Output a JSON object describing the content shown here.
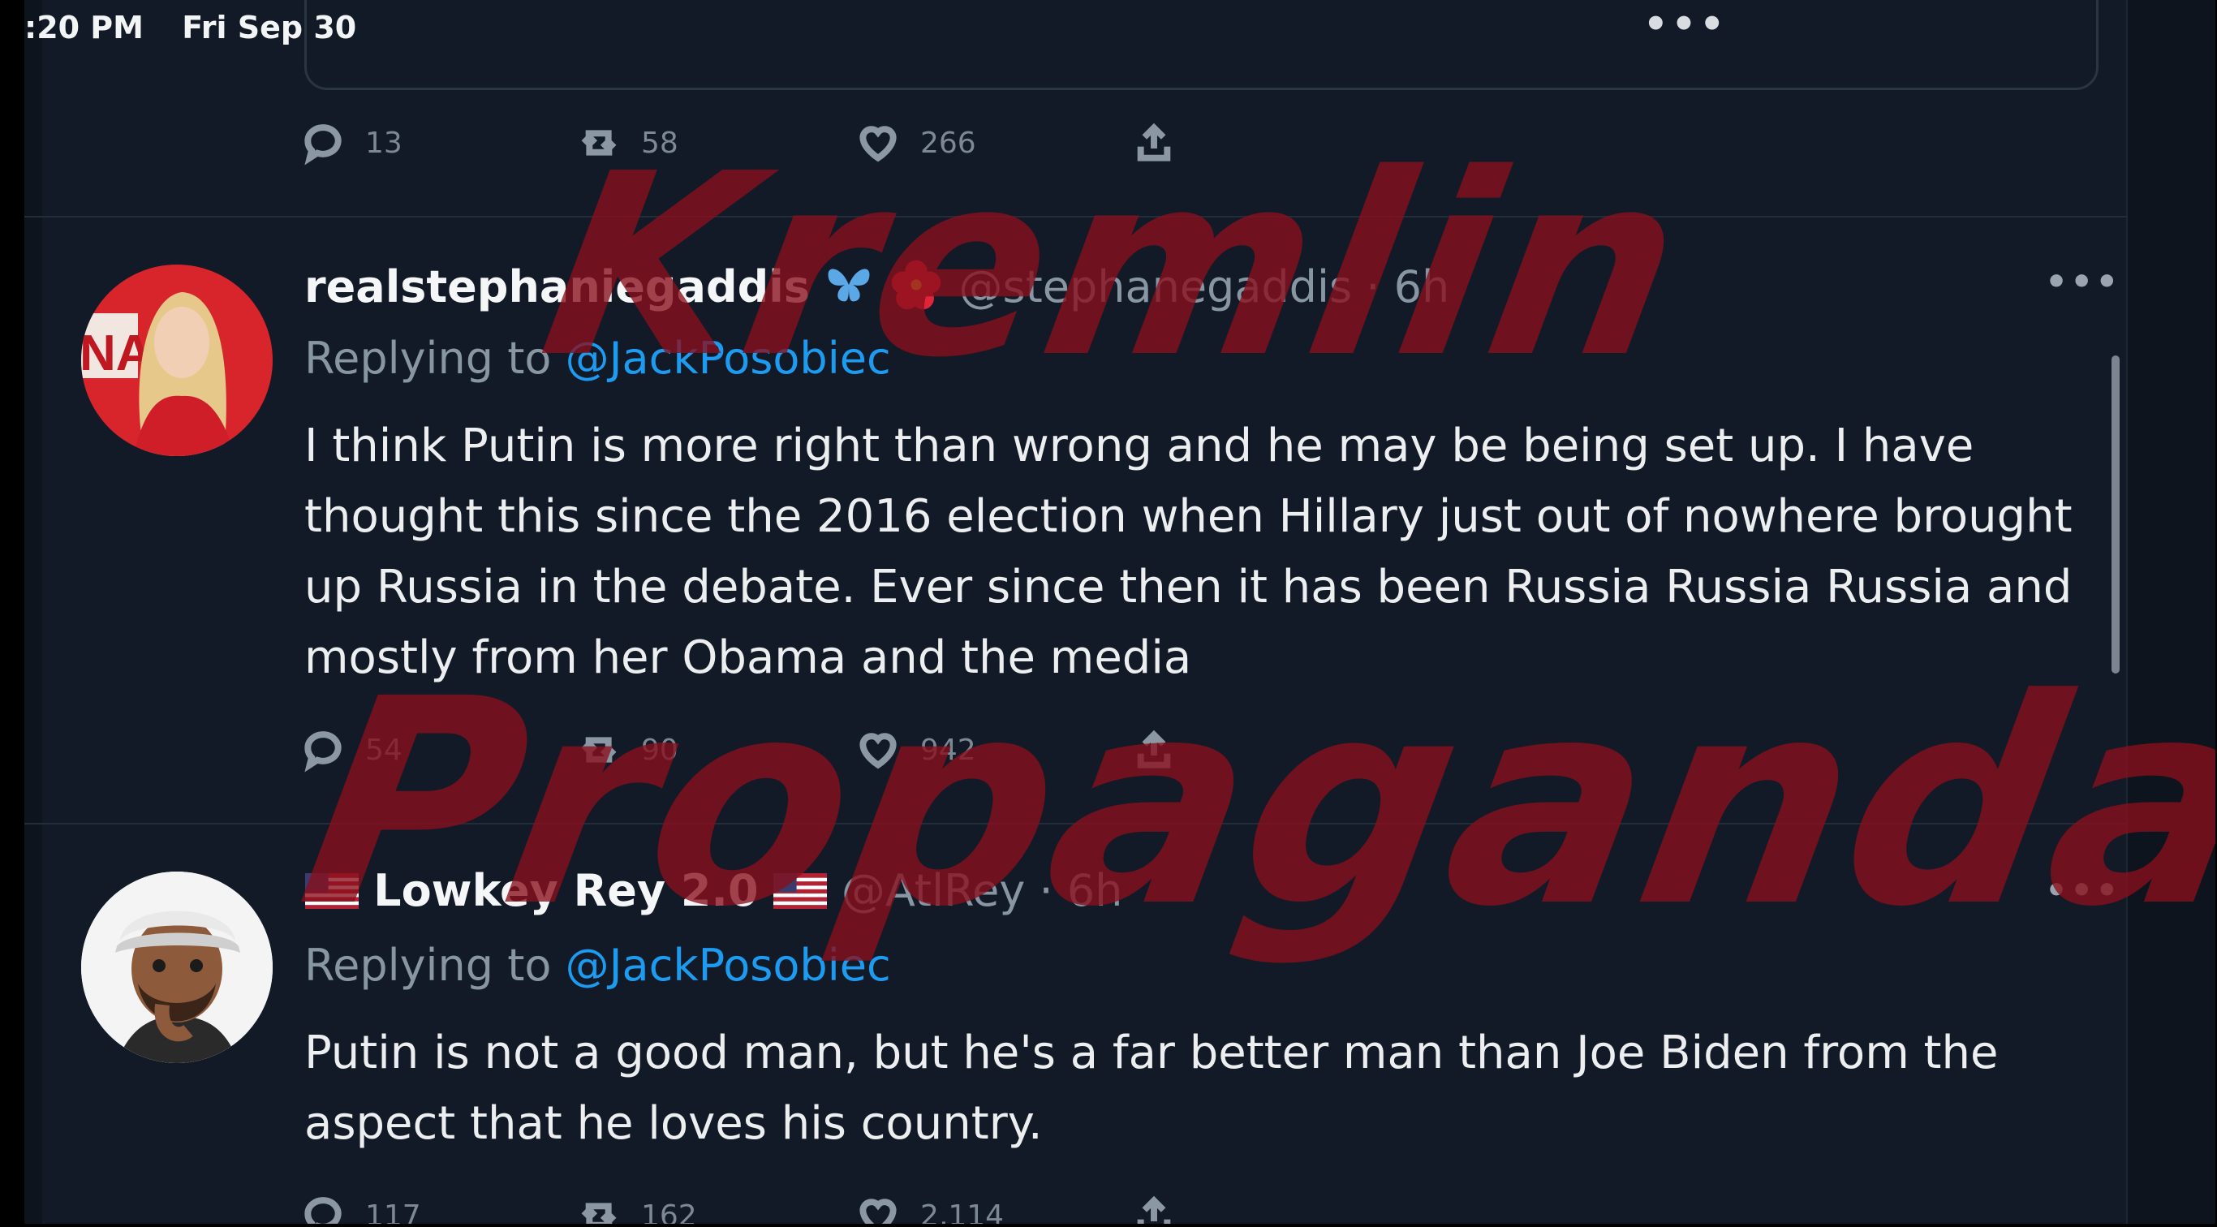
{
  "status": {
    "time": ":20 PM",
    "date": "Fri Sep 30"
  },
  "prev_tweet": {
    "replies": "13",
    "retweets": "58",
    "likes": "266"
  },
  "tweets": [
    {
      "name": "realstephaniegaddis",
      "handle": "@stephanegaddis",
      "time": "· 6h",
      "replying_prefix": "Replying to ",
      "replying_to": "@JackPosobiec",
      "text": "I think Putin is more right than wrong and he may be being set up. I have thought this since the 2016 election when Hillary just out of nowhere brought up Russia in the debate. Ever since then it has been Russia Russia Russia and mostly from her Obama and the media",
      "replies": "54",
      "retweets": "90",
      "likes": "942"
    },
    {
      "name": "Lowkey Rey 2.0",
      "handle": "@AtlRey",
      "time": "· 6h",
      "replying_prefix": "Replying to ",
      "replying_to": "@JackPosobiec",
      "text": "Putin is not a good man, but he's a far better man than Joe Biden from the aspect that he loves his country.",
      "replies": "117",
      "retweets": "162",
      "likes": "2,114"
    }
  ],
  "overlay": {
    "line1": "Kremlin",
    "line2": "Propaganda"
  },
  "colors": {
    "background": "#111a26",
    "accent": "#1d9bf0",
    "overlay": "#8a0f1c"
  }
}
